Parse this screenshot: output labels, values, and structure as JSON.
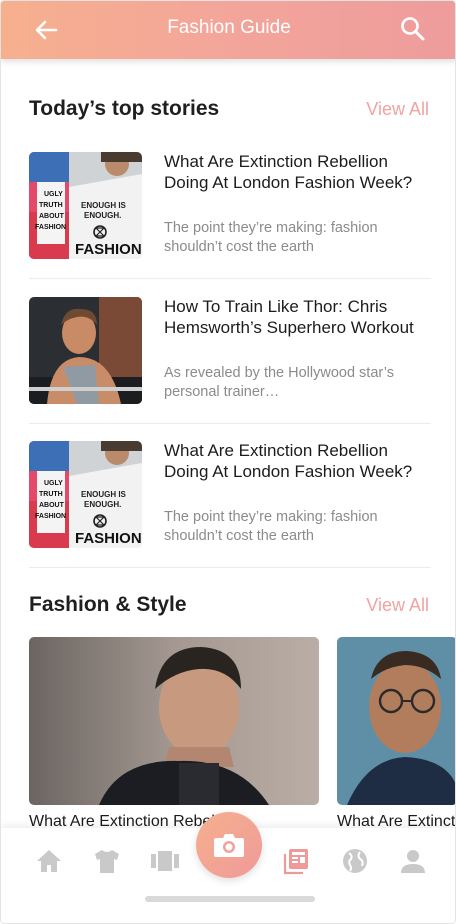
{
  "header": {
    "title": "Fashion Guide",
    "back_icon": "arrow-left-icon",
    "search_icon": "search-icon",
    "gradient": [
      "#f6b08e",
      "#ee9c9c"
    ]
  },
  "top_stories": {
    "heading": "Today’s top stories",
    "view_all": "View All",
    "items": [
      {
        "title": "What Are Extinction Rebellion Doing At London Fashion Week?",
        "description": "The point they’re making: fashion shouldn’t cost the earth",
        "image": "protest-sign-photo",
        "sign_lines": [
          "ENOUGH IS",
          "ENOUGH.",
          "FASHION"
        ],
        "side_lines": [
          "UGLY",
          "TRUTH",
          "ABOUT",
          "FASHION"
        ]
      },
      {
        "title": "How To Train Like Thor: Chris Hemsworth’s Superhero Workout",
        "description": "As revealed by the Hollywood star’s personal trainer…",
        "image": "man-workout-photo"
      },
      {
        "title": "What Are Extinction Rebellion Doing At London Fashion Week?",
        "description": "The point they’re making: fashion shouldn’t cost the earth",
        "image": "protest-sign-photo",
        "sign_lines": [
          "ENOUGH IS",
          "ENOUGH.",
          "FASHION"
        ],
        "side_lines": [
          "UGLY",
          "TRUTH",
          "ABOUT",
          "FASHION"
        ]
      }
    ]
  },
  "fashion_style": {
    "heading": "Fashion & Style",
    "view_all": "View All",
    "cards": [
      {
        "title": "What Are Extinction Rebellion",
        "image": "man-portrait-photo"
      },
      {
        "title": "What Are Extinction",
        "image": "man-glasses-photo"
      }
    ]
  },
  "bottom_nav": {
    "items": [
      "home-icon",
      "shirt-icon",
      "gallery-icon",
      "camera-icon",
      "news-icon",
      "globe-icon",
      "person-icon"
    ],
    "active": "news-icon",
    "inactive_color": "#c9c9c9",
    "active_color": "#ef9a98"
  }
}
